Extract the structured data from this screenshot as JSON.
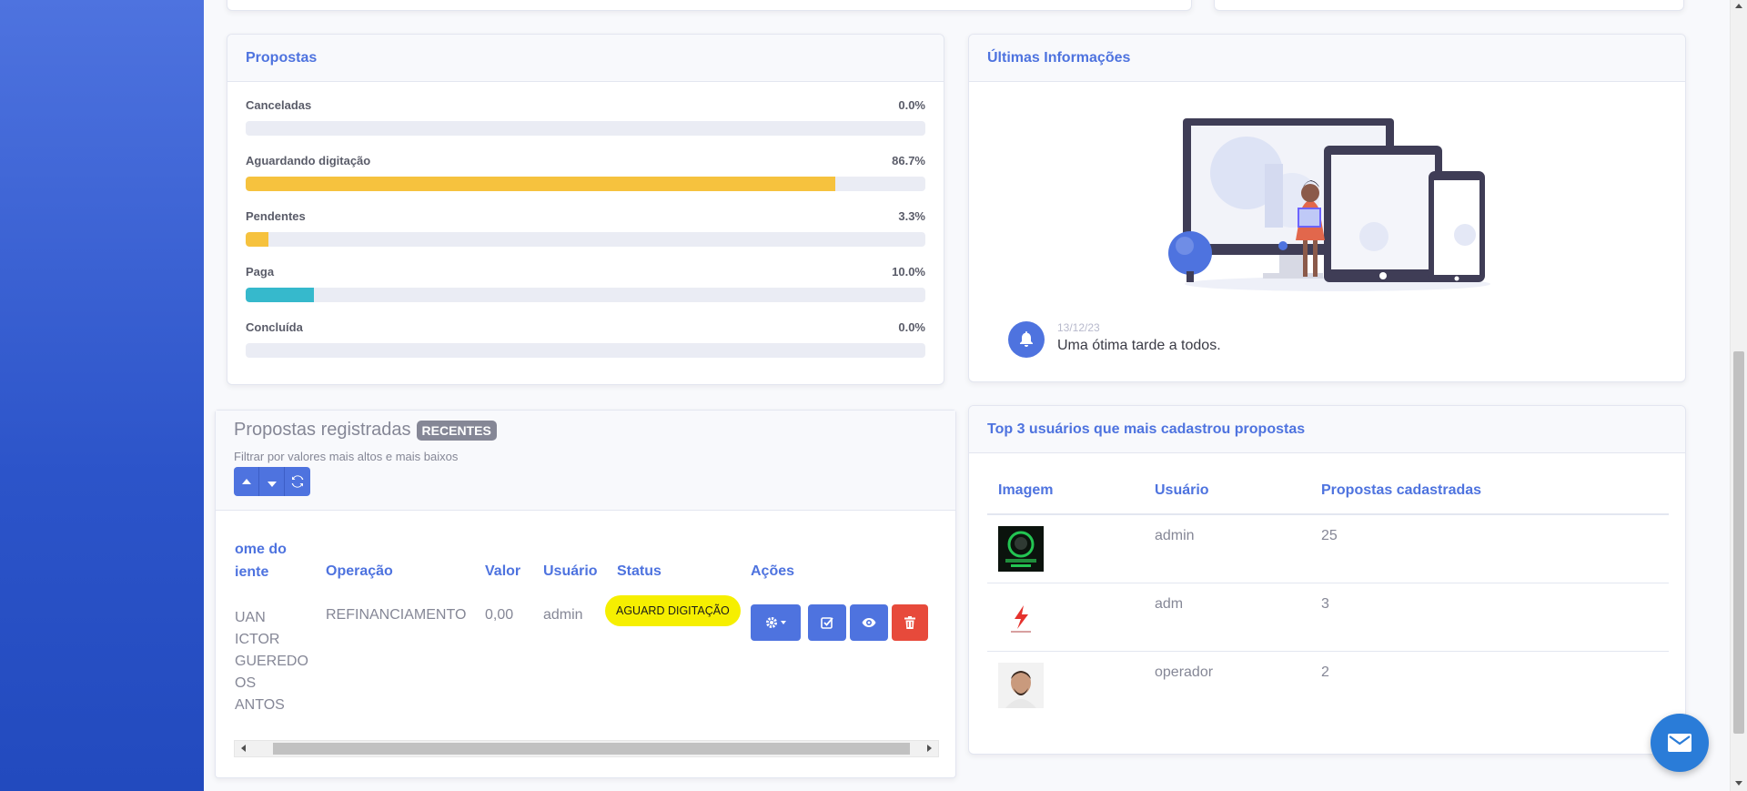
{
  "propostas_card": {
    "title": "Propostas",
    "items": [
      {
        "label": "Canceladas",
        "percent_text": "0.0%",
        "value": 0.0,
        "color": "#e74a3b"
      },
      {
        "label": "Aguardando digitação",
        "percent_text": "86.7%",
        "value": 86.7,
        "color": "#f6c23e"
      },
      {
        "label": "Pendentes",
        "percent_text": "3.3%",
        "value": 3.3,
        "color": "#f6c23e"
      },
      {
        "label": "Paga",
        "percent_text": "10.0%",
        "value": 10.0,
        "color": "#36b9cc"
      },
      {
        "label": "Concluída",
        "percent_text": "0.0%",
        "value": 0.0,
        "color": "#1cc88a"
      }
    ]
  },
  "info_card": {
    "title": "Últimas Informações",
    "notice_date": "13/12/23",
    "notice_text": "Uma ótima tarde a todos."
  },
  "registradas_card": {
    "title": "Propostas registradas",
    "badge": "RECENTES",
    "subtitle": "Filtrar por valores mais altos e mais baixos",
    "columns": {
      "nome_line1": "ome do",
      "nome_line2": "iente",
      "operacao": "Operação",
      "valor": "Valor",
      "usuario": "Usuário",
      "status": "Status",
      "acoes": "Ações"
    },
    "row": {
      "nome_lines": [
        "UAN",
        "ICTOR",
        "GUEREDO",
        "OS",
        "ANTOS"
      ],
      "operacao": "REFINANCIAMENTO",
      "valor": "0,00",
      "usuario": "admin",
      "status": "AGUARD DIGITAÇÃO"
    }
  },
  "top3_card": {
    "title": "Top 3 usuários que mais cadastrou propostas",
    "columns": {
      "imagem": "Imagem",
      "usuario": "Usuário",
      "propostas": "Propostas cadastradas"
    },
    "rows": [
      {
        "usuario": "admin",
        "propostas": "25"
      },
      {
        "usuario": "adm",
        "propostas": "3"
      },
      {
        "usuario": "operador",
        "propostas": "2"
      }
    ]
  },
  "colors": {
    "primary": "#4e73df",
    "danger": "#e74a3b",
    "warning_badge": "#f6ef00"
  }
}
